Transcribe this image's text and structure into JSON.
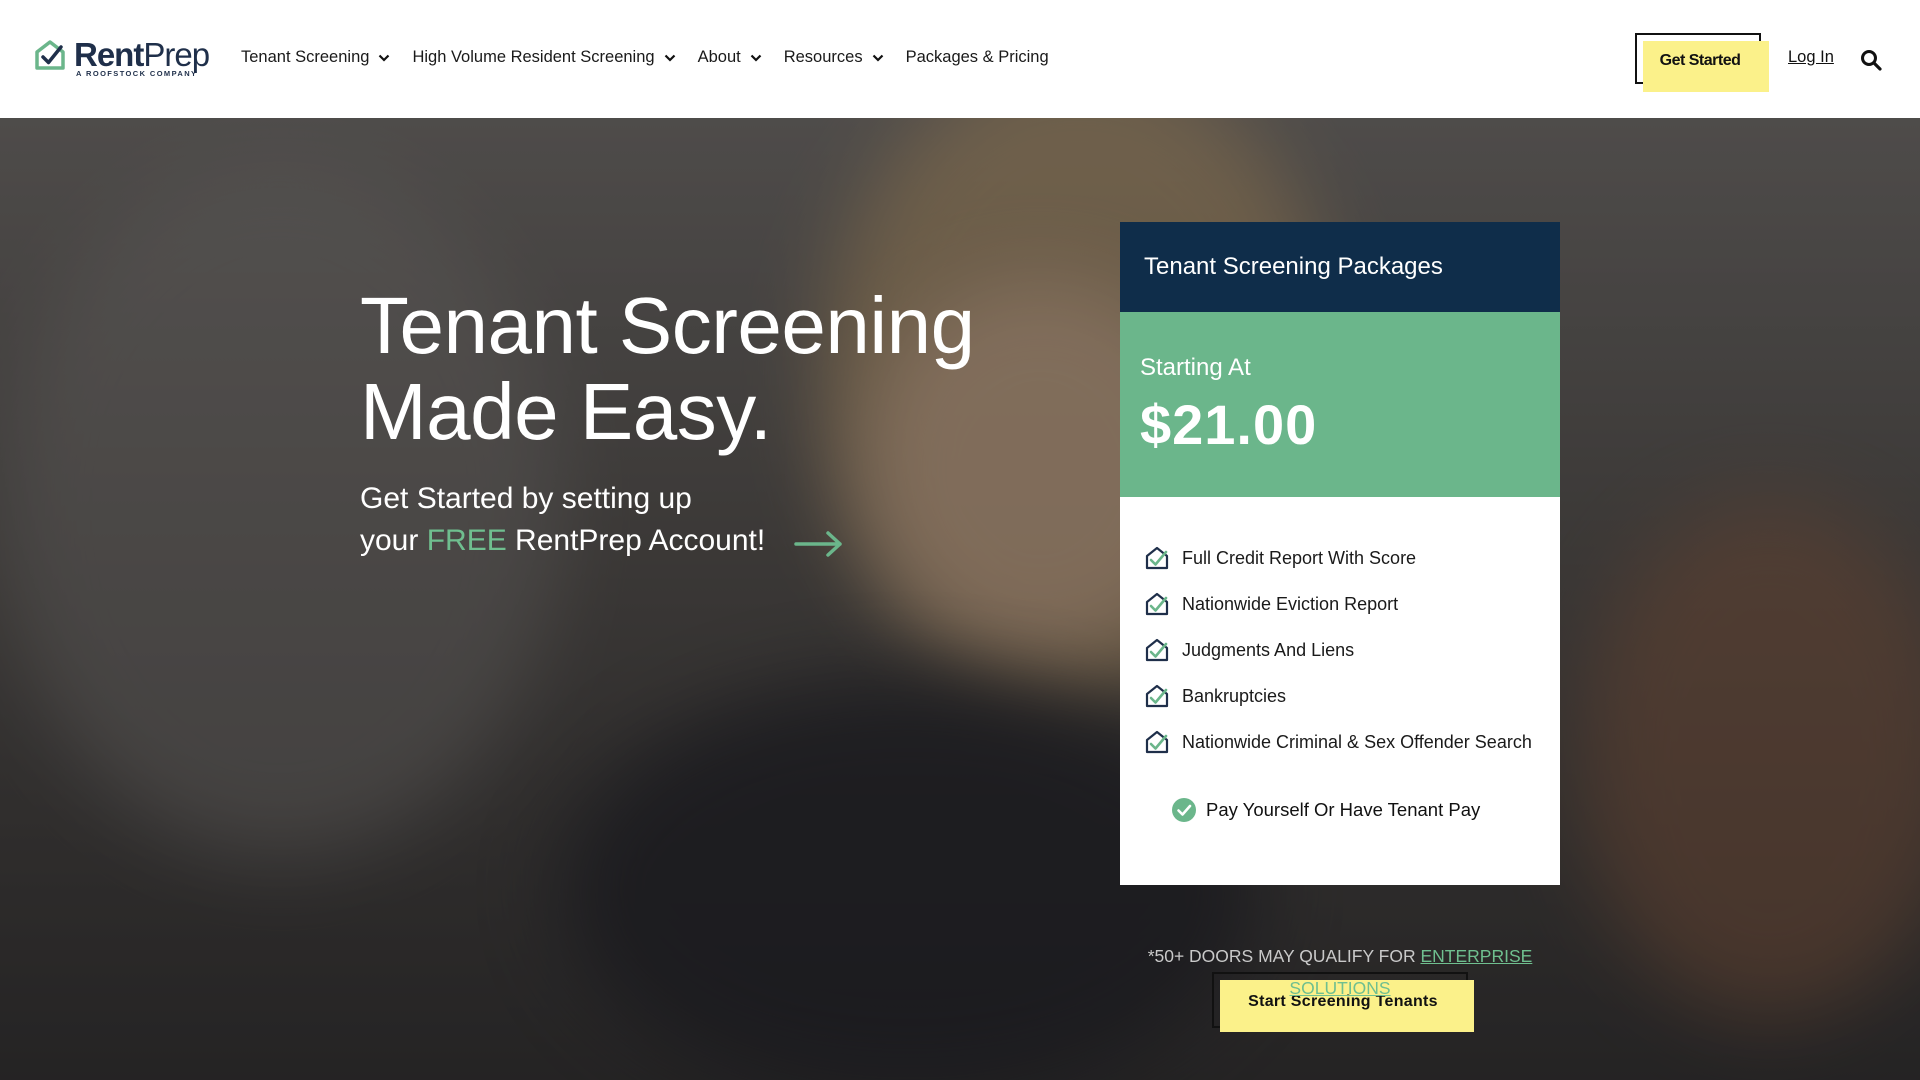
{
  "brand": {
    "name_bold": "Rent",
    "name_regular": "Prep",
    "tagline": "A ROOFSTOCK COMPANY",
    "accent": "#6bb68b",
    "navy": "#0f2d4a",
    "yellow": "#fbf18a"
  },
  "nav": {
    "items": [
      {
        "label": "Tenant Screening",
        "dropdown": true
      },
      {
        "label": "High Volume Resident Screening",
        "dropdown": true
      },
      {
        "label": "About",
        "dropdown": true
      },
      {
        "label": "Resources",
        "dropdown": true
      },
      {
        "label": "Packages & Pricing",
        "dropdown": false
      }
    ],
    "get_started": "Get Started",
    "login": "Log In",
    "search_icon": "search-icon"
  },
  "hero": {
    "title_line1": "Tenant Screening",
    "title_line2": "Made Easy.",
    "sub_line1": "Get Started by setting up",
    "sub_line2_pre": "your ",
    "sub_line2_free": "FREE",
    "sub_line2_post": " RentPrep Account!"
  },
  "card": {
    "title": "Tenant Screening Packages",
    "starting_at": "Starting At",
    "price": "$21.00",
    "features": [
      "Full Credit Report With Score",
      "Nationwide Eviction Report",
      "Judgments And Liens",
      "Bankruptcies",
      "Nationwide Criminal & Sex Offender Search"
    ],
    "pay_line": "Pay Yourself Or Have Tenant Pay",
    "cta": "Start Screening Tenants"
  },
  "note": {
    "text": "*50+ DOORS MAY QUALIFY FOR ",
    "link_line1": "ENTERPRISE",
    "link_line2": "SOLUTIONS"
  }
}
